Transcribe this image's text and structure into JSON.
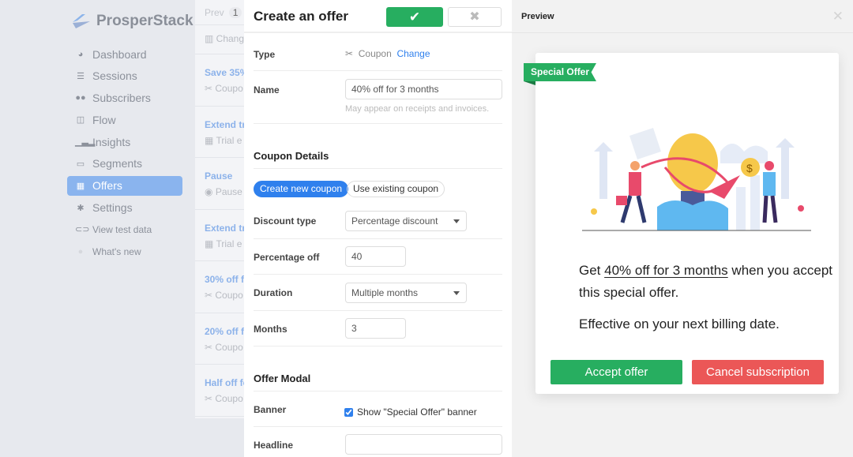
{
  "app": {
    "brand": "ProsperStack"
  },
  "sidebar": {
    "items": [
      {
        "label": "Dashboard",
        "icon": "pie-chart-icon"
      },
      {
        "label": "Sessions",
        "icon": "list-icon"
      },
      {
        "label": "Subscribers",
        "icon": "users-icon"
      },
      {
        "label": "Flow",
        "icon": "columns-icon"
      },
      {
        "label": "Insights",
        "icon": "bar-chart-icon"
      },
      {
        "label": "Segments",
        "icon": "id-card-icon"
      },
      {
        "label": "Offers",
        "icon": "gift-icon",
        "active": true
      },
      {
        "label": "Settings",
        "icon": "gear-icon"
      }
    ],
    "test_data": "View test data",
    "whats_new": "What's new"
  },
  "list": {
    "prev": "Prev",
    "page": "1",
    "first": "Chang",
    "items": [
      {
        "title": "Save 35%",
        "sub": "Coupo",
        "icon": "scissors-icon"
      },
      {
        "title": "Extend tri",
        "sub": "Trial e",
        "icon": "calendar-icon"
      },
      {
        "title": "Pause",
        "sub": "Pause",
        "icon": "pause-icon"
      },
      {
        "title": "Extend tri",
        "sub": "Trial e",
        "icon": "calendar-icon"
      },
      {
        "title": "30% off fo",
        "sub": "Coupo",
        "icon": "scissors-icon"
      },
      {
        "title": "20% off fo",
        "sub": "Coupo",
        "icon": "scissors-icon"
      },
      {
        "title": "Half off fo",
        "sub": "Coupo",
        "icon": "scissors-icon"
      }
    ]
  },
  "form": {
    "title": "Create an offer",
    "type_label": "Type",
    "type_value": "Coupon",
    "change": "Change",
    "name_label": "Name",
    "name_value": "40% off for 3 months",
    "name_help": "May appear on receipts and invoices.",
    "coupon_details": "Coupon Details",
    "create_new": "Create new coupon",
    "use_existing": "Use existing coupon",
    "discount_type_label": "Discount type",
    "discount_type_value": "Percentage discount",
    "percentage_label": "Percentage off",
    "percentage_value": "40",
    "duration_label": "Duration",
    "duration_value": "Multiple months",
    "months_label": "Months",
    "months_value": "3",
    "offer_modal": "Offer Modal",
    "banner_label": "Banner",
    "banner_checkbox": "Show \"Special Offer\" banner",
    "banner_checked": true,
    "headline_label": "Headline",
    "headline_value": ""
  },
  "preview": {
    "title": "Preview",
    "ribbon": "Special Offer",
    "text_pre": "Get ",
    "text_link": "40% off for 3 months",
    "text_post": " when you accept this special offer.",
    "effective": "Effective on your next billing date.",
    "accept": "Accept offer",
    "cancel": "Cancel subscription"
  },
  "colors": {
    "green": "#27ae60",
    "red": "#eb5757",
    "blue": "#2f80ed"
  }
}
